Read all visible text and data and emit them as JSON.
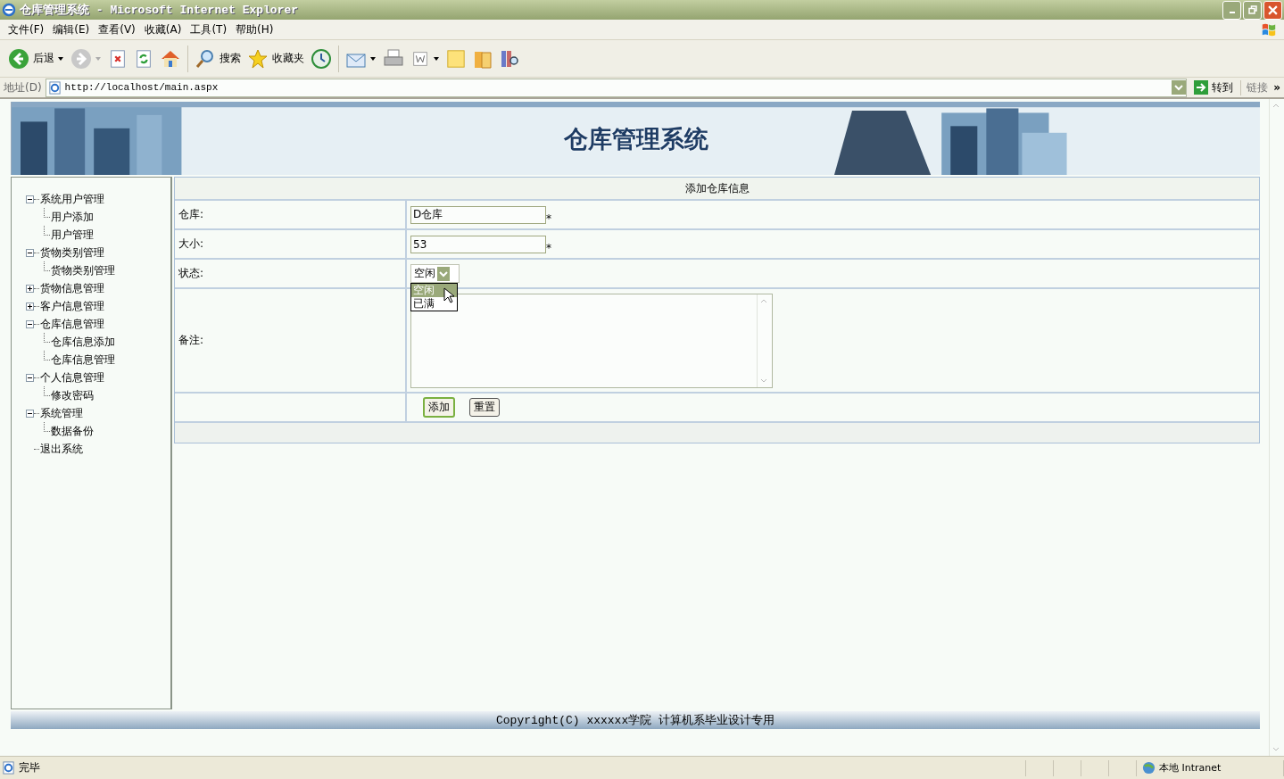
{
  "window": {
    "title": "仓库管理系统 - Microsoft Internet Explorer"
  },
  "menu": [
    "文件(F)",
    "编辑(E)",
    "查看(V)",
    "收藏(A)",
    "工具(T)",
    "帮助(H)"
  ],
  "toolbar": [
    {
      "kind": "back",
      "label": "后退"
    },
    {
      "kind": "forward"
    },
    {
      "kind": "stop"
    },
    {
      "kind": "refresh"
    },
    {
      "kind": "home"
    },
    {
      "kind": "search",
      "label": "搜索"
    },
    {
      "kind": "favorites",
      "label": "收藏夹"
    },
    {
      "kind": "history"
    },
    {
      "kind": "mail"
    },
    {
      "kind": "print"
    },
    {
      "kind": "edit"
    },
    {
      "kind": "note"
    },
    {
      "kind": "folder"
    },
    {
      "kind": "research"
    }
  ],
  "address": {
    "label": "地址(D)",
    "value": "http://localhost/main.aspx",
    "go": "转到",
    "links": "链接",
    "more": "»"
  },
  "banner": {
    "title": "仓库管理系统"
  },
  "tree": [
    {
      "label": "系统用户管理",
      "expanded": true,
      "children": [
        {
          "label": "用户添加"
        },
        {
          "label": "用户管理"
        }
      ]
    },
    {
      "label": "货物类别管理",
      "expanded": true,
      "children": [
        {
          "label": "货物类别管理"
        }
      ]
    },
    {
      "label": "货物信息管理",
      "expanded": false
    },
    {
      "label": "客户信息管理",
      "expanded": false
    },
    {
      "label": "仓库信息管理",
      "expanded": true,
      "children": [
        {
          "label": "仓库信息添加"
        },
        {
          "label": "仓库信息管理"
        }
      ]
    },
    {
      "label": "个人信息管理",
      "expanded": true,
      "children": [
        {
          "label": "修改密码"
        }
      ]
    },
    {
      "label": "系统管理",
      "expanded": true,
      "children": [
        {
          "label": "数据备份"
        }
      ]
    },
    {
      "label": "退出系统"
    }
  ],
  "form": {
    "title": "添加仓库信息",
    "rows": [
      {
        "kind": "text",
        "label": "仓库:",
        "value": "D仓库",
        "mark": "*"
      },
      {
        "kind": "text",
        "label": "大小:",
        "value": "53",
        "mark": "*"
      },
      {
        "kind": "select",
        "label": "状态:",
        "value": "空闲",
        "open": true,
        "options": [
          {
            "label": "空闲",
            "selected": true
          },
          {
            "label": "已满",
            "selected": false
          }
        ]
      },
      {
        "kind": "textarea",
        "label": "备注:"
      }
    ],
    "buttons": [
      {
        "label": "添加",
        "default": true
      },
      {
        "label": "重置",
        "default": false
      }
    ]
  },
  "footer": "Copyright(C) xxxxxx学院 计算机系毕业设计专用",
  "status": {
    "text": "完毕",
    "zone": "本地 Intranet"
  }
}
